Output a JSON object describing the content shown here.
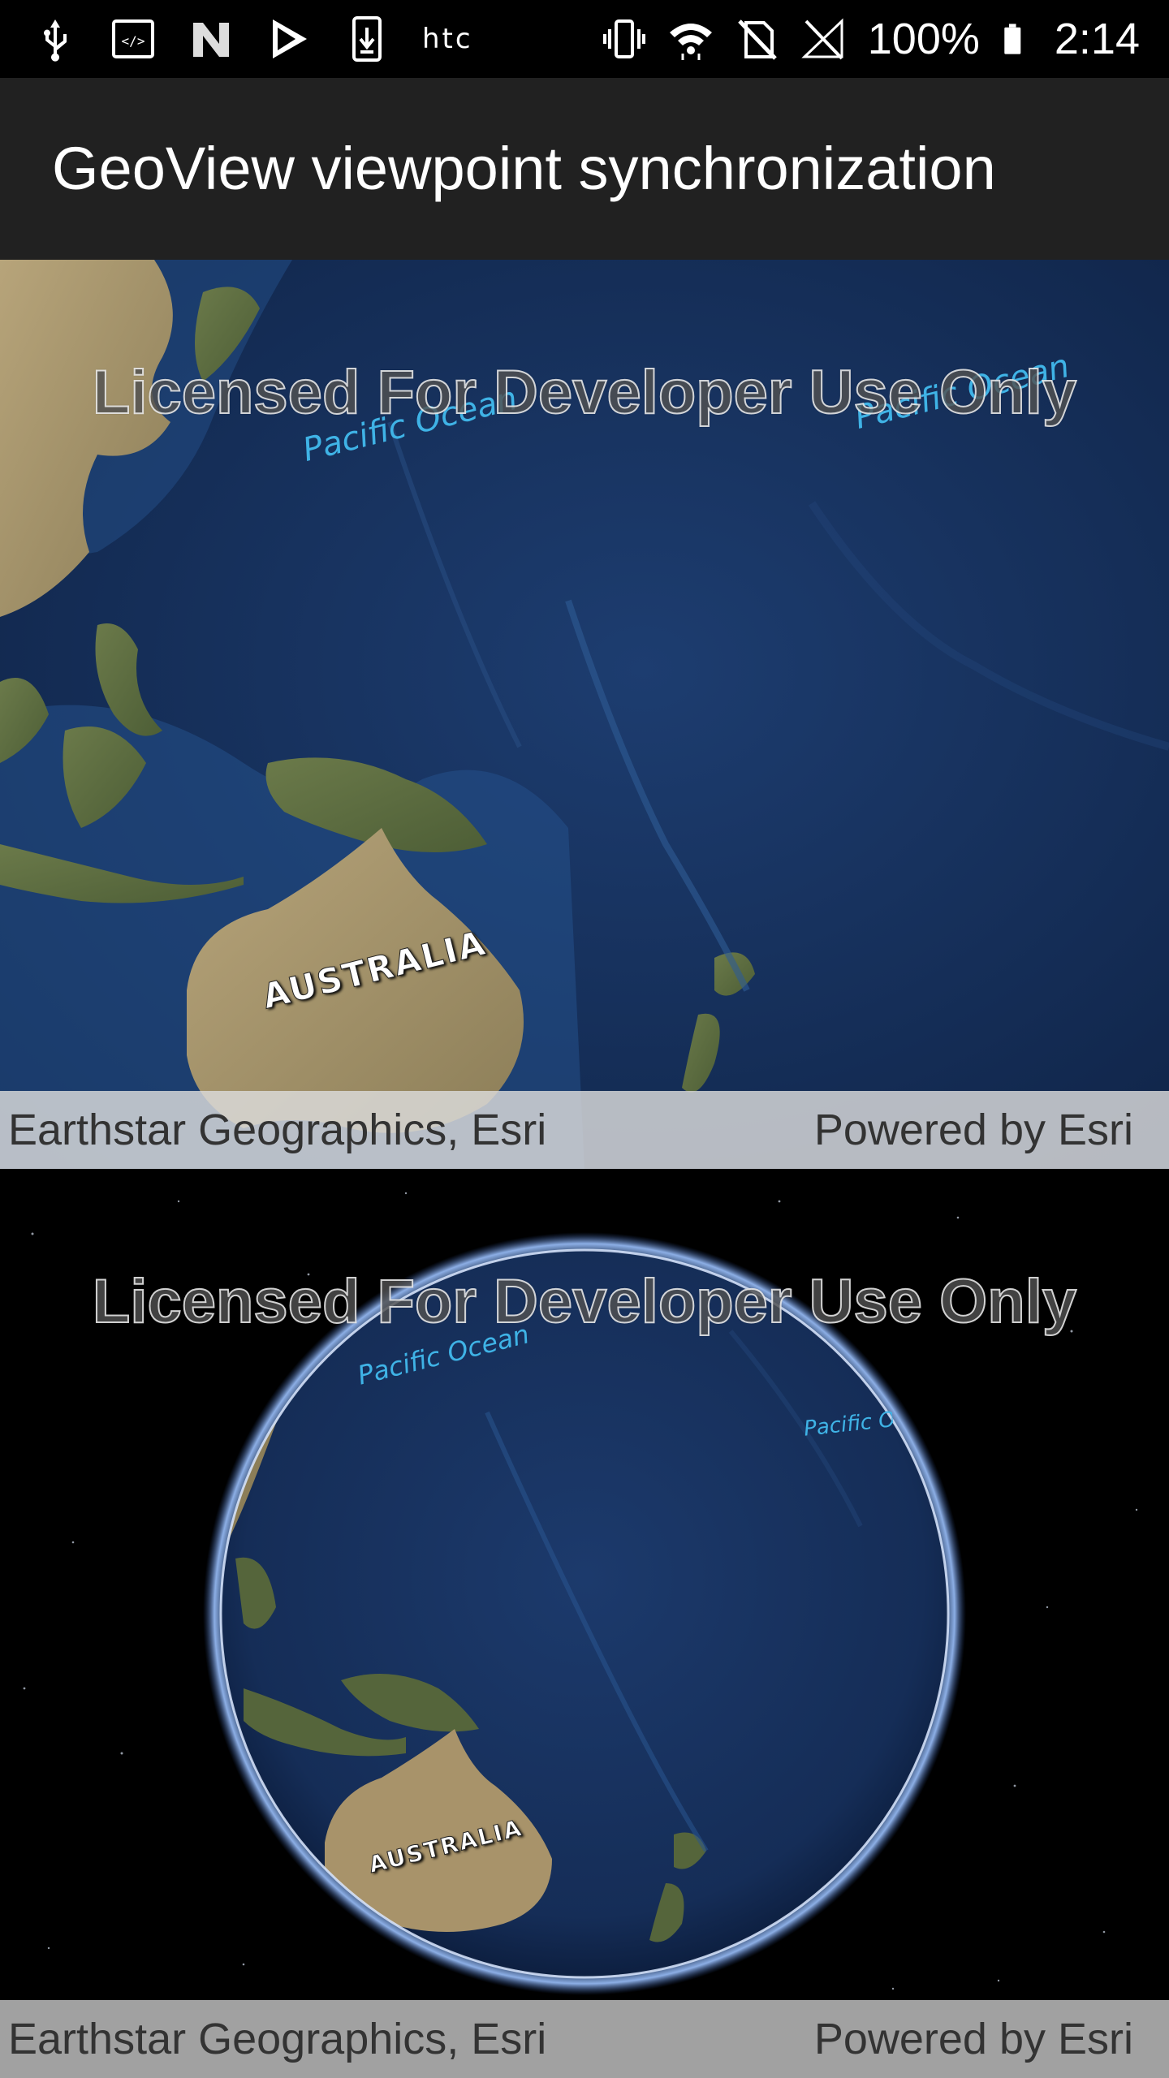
{
  "status_bar": {
    "left_icons": [
      "usb-icon",
      "developer-icon",
      "n-app-icon",
      "play-store-icon",
      "download-icon"
    ],
    "carrier": "htc",
    "right_icons": [
      "vibrate-icon",
      "wifi-icon",
      "no-sim-icon",
      "signal-icon"
    ],
    "battery_percent": "100%",
    "time": "2:14"
  },
  "app_bar": {
    "title": "GeoView viewpoint synchronization"
  },
  "map_view": {
    "watermark": "Licensed For Developer Use Only",
    "labels": {
      "ocean_left": "Pacific Ocean",
      "ocean_right": "Pacific Ocean",
      "country": "AUSTRALIA"
    },
    "attribution": "Earthstar Geographics, Esri",
    "powered_by": "Powered by Esri"
  },
  "scene_view": {
    "watermark": "Licensed For Developer Use Only",
    "labels": {
      "ocean_left": "Pacific Ocean",
      "ocean_right": "Pacific Ocean",
      "country": "AUSTRALIA"
    },
    "attribution": "Earthstar Geographics, Esri",
    "powered_by": "Powered by Esri"
  },
  "colors": {
    "status_bar_bg": "#000000",
    "app_bar_bg": "#212121",
    "ocean": "#1b3766",
    "land": "#a8936a",
    "label_ocean": "#3fb3e6"
  }
}
